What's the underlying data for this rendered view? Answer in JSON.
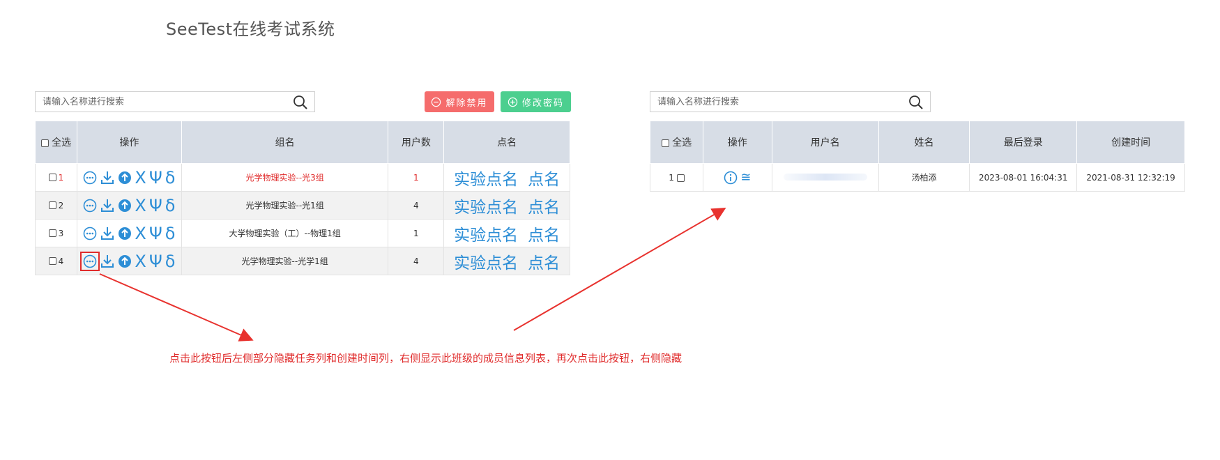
{
  "app": {
    "title": "SeeTest在线考试系统"
  },
  "left_panel": {
    "search": {
      "placeholder": "请输入名称进行搜索"
    },
    "buttons": {
      "unban_label": "解除禁用",
      "change_password_label": "修改密码"
    },
    "columns": {
      "select_all": "全选",
      "operations": "操作",
      "group_name": "组名",
      "user_count": "用户数",
      "roll_call": "点名"
    },
    "rows": [
      {
        "index": "1",
        "group_name": "光学物理实验--光3组",
        "user_count": "1",
        "roll_call_exp": "实验点名",
        "roll_call": "点名",
        "highlighted_red": true
      },
      {
        "index": "2",
        "group_name": "光学物理实验--光1组",
        "user_count": "4",
        "roll_call_exp": "实验点名",
        "roll_call": "点名"
      },
      {
        "index": "3",
        "group_name": "大学物理实验（工）--物理1组",
        "user_count": "1",
        "roll_call_exp": "实验点名",
        "roll_call": "点名"
      },
      {
        "index": "4",
        "group_name": "光学物理实验--光学1组",
        "user_count": "4",
        "roll_call_exp": "实验点名",
        "roll_call": "点名"
      }
    ],
    "op_glyphs": {
      "chi": "X",
      "psi": "Ψ",
      "delta": "δ"
    }
  },
  "right_panel": {
    "search": {
      "placeholder": "请输入名称进行搜索"
    },
    "columns": {
      "select_all": "全选",
      "operations": "操作",
      "username": "用户名",
      "name": "姓名",
      "last_login": "最后登录",
      "created_at": "创建时间"
    },
    "rows": [
      {
        "index": "1",
        "username": "",
        "name": "汤柏添",
        "last_login": "2023-08-01 16:04:31",
        "created_at": "2021-08-31 12:32:19",
        "op_glyph": "≅"
      }
    ]
  },
  "annotation": {
    "text": "点击此按钮后左侧部分隐藏任务列和创建时间列，右侧显示此班级的成员信息列表，再次点击此按钮，右侧隐藏"
  },
  "colors": {
    "header_bg": "#d7dde6",
    "accent_blue": "#2d8ed6",
    "danger_red": "#f56c6c",
    "success_green": "#4ccf8f",
    "annotation_red": "#e02b2b"
  }
}
